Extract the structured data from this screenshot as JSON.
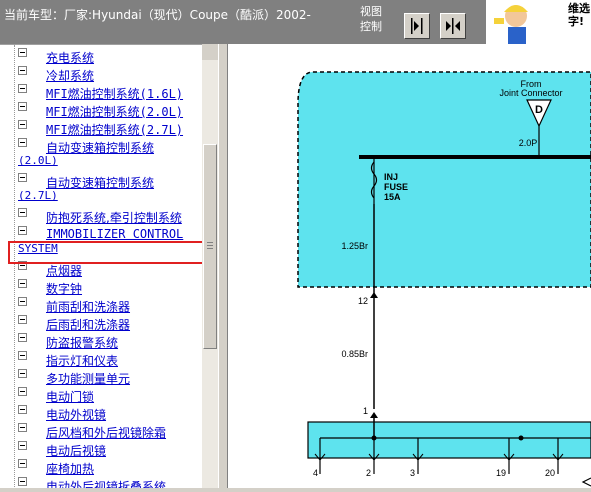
{
  "header": {
    "car_label": "当前车型：厂家:Hyundai（现代）Coupe（酷派）2002-",
    "view_label": "视图控制",
    "logo_text": "维选字!"
  },
  "tree": [
    {
      "label": "充电系统"
    },
    {
      "label": "冷却系统"
    },
    {
      "label": "MFI燃油控制系统(1.6L)"
    },
    {
      "label": "MFI燃油控制系统(2.0L)"
    },
    {
      "label": "MFI燃油控制系统(2.7L)"
    },
    {
      "label": "自动变速箱控制系统",
      "cont": "(2.0L)"
    },
    {
      "label": "自动变速箱控制系统",
      "cont": "(2.7L)"
    },
    {
      "label": "防抱死系统,牵引控制系统",
      "selected": true
    },
    {
      "label": "IMMOBILIZER CONTROL",
      "cont": "SYSTEM"
    },
    {
      "label": "点烟器"
    },
    {
      "label": "数字钟"
    },
    {
      "label": "前雨刮和洗涤器"
    },
    {
      "label": "后雨刮和洗涤器"
    },
    {
      "label": "防盗报警系统"
    },
    {
      "label": "指示灯和仪表"
    },
    {
      "label": "多功能测量单元"
    },
    {
      "label": "电动门锁"
    },
    {
      "label": "电动外视镜"
    },
    {
      "label": "后风档和外后视镜除霜"
    },
    {
      "label": "电动后视镜"
    },
    {
      "label": "座椅加热"
    },
    {
      "label": "电动外后视镜拆叠系统"
    }
  ],
  "diagram": {
    "from_label_1": "From",
    "from_label_2": "Joint Connector",
    "connector_letter": "D",
    "wire_top": "2.0P",
    "fuse_1": "INJ",
    "fuse_2": "FUSE",
    "fuse_3": "15A",
    "wire_mid": "1.25Br",
    "pin_12": "12",
    "wire_low": "0.85Br",
    "pin_1": "1",
    "pins_bottom": [
      "4",
      "2",
      "3",
      "19",
      "20"
    ]
  },
  "colors": {
    "cyan_fill": "#5ee3ee",
    "link_blue": "#0000cc",
    "highlight": "#e02020"
  }
}
